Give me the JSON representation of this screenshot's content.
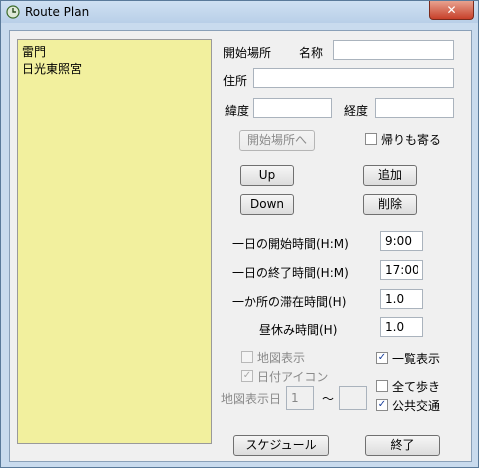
{
  "window": {
    "title": "Route Plan",
    "close": "✕"
  },
  "places": [
    "雷門",
    "日光東照宮"
  ],
  "form": {
    "start_place_label": "開始場所",
    "name_label": "名称",
    "name_value": "",
    "address_label": "住所",
    "address_value": "",
    "latitude_label": "緯度",
    "latitude_value": "",
    "longitude_label": "経度",
    "longitude_value": "",
    "set_start_button": "開始場所へ",
    "return_checkbox": {
      "label": "帰りも寄る",
      "checked": false
    }
  },
  "buttons": {
    "up": "Up",
    "down": "Down",
    "add": "追加",
    "delete": "削除",
    "schedule": "スケジュール",
    "close": "終了"
  },
  "times": {
    "day_start_label": "一日の開始時間(H:M)",
    "day_start_value": "9:00",
    "day_end_label": "一日の終了時間(H:M)",
    "day_end_value": "17:00",
    "stay_label": "一か所の滞在時間(H)",
    "stay_value": "1.0",
    "lunch_label": "昼休み時間(H)",
    "lunch_value": "1.0"
  },
  "options": {
    "map_display": {
      "label": "地図表示",
      "checked": false,
      "enabled": false
    },
    "date_icon": {
      "label": "日付アイコン",
      "checked": true,
      "enabled": false
    },
    "list_display": {
      "label": "一覧表示",
      "checked": true
    },
    "walk_all": {
      "label": "全て歩き",
      "checked": false
    },
    "public_transport": {
      "label": "公共交通",
      "checked": true
    },
    "map_display_day_label": "地図表示日",
    "map_day_from": "1",
    "tilde": "～",
    "map_day_to": ""
  }
}
